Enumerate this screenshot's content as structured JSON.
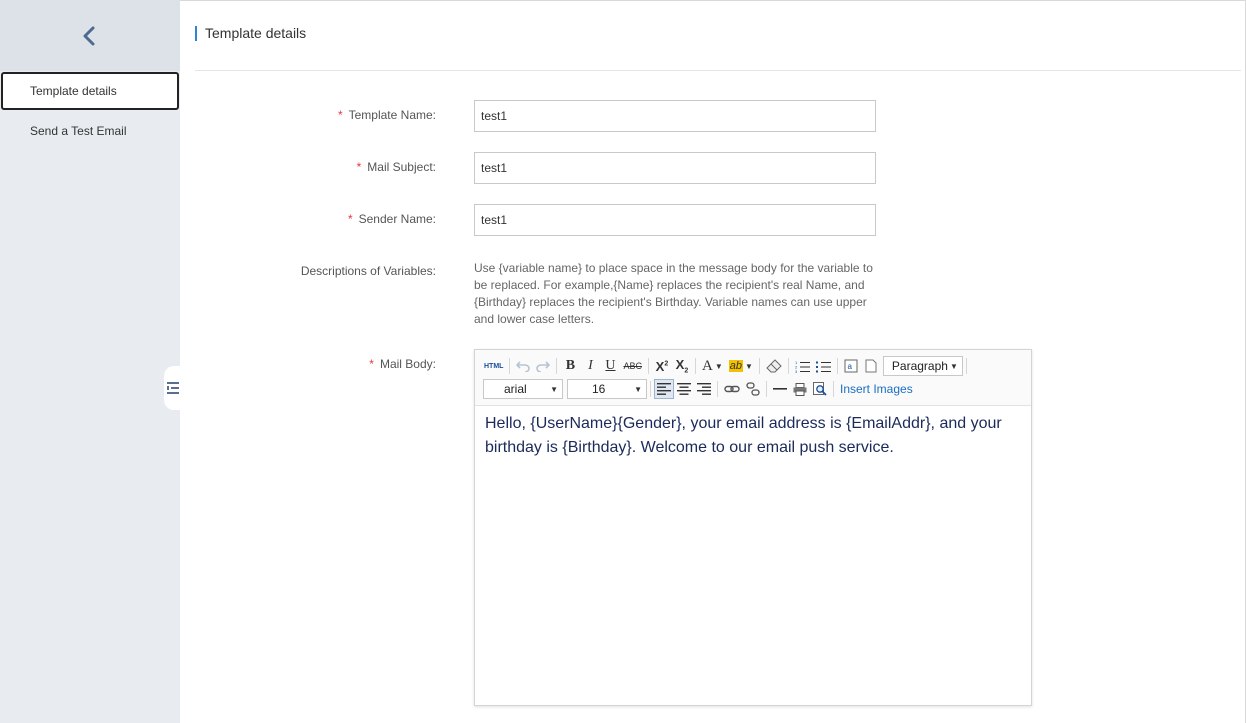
{
  "sidebar": {
    "back_icon": "chevron-left-icon",
    "items": [
      {
        "label": "Template details",
        "active": true
      },
      {
        "label": "Send a Test Email",
        "active": false
      }
    ],
    "collapse_icon": "collapse-menu-icon"
  },
  "header": {
    "title": "Template details"
  },
  "form": {
    "template_name": {
      "label": "Template Name:",
      "value": "test1",
      "required": true
    },
    "mail_subject": {
      "label": "Mail Subject:",
      "value": "test1",
      "required": true
    },
    "sender_name": {
      "label": "Sender Name:",
      "value": "test1",
      "required": true
    },
    "variables": {
      "label": "Descriptions of Variables:",
      "text": "Use {variable name} to place space in the message body for the variable to be replaced. For example,{Name} replaces the recipient's real Name, and {Birthday} replaces the recipient's Birthday. Variable names can use upper and lower case letters."
    },
    "mail_body": {
      "label": "Mail Body:",
      "required": true,
      "content": "Hello, {UserName}{Gender}, your email address is {EmailAddr}, and your birthday is {Birthday}. Welcome to our email push service."
    }
  },
  "required_mark": "*",
  "editor_toolbar": {
    "html_label": "HTML",
    "bold": "B",
    "italic": "I",
    "underline": "U",
    "strike": "ABC",
    "font_color": "A",
    "highlight": "ab",
    "paragraph_select": "Paragraph",
    "font_family_select": "arial",
    "font_size_select": "16",
    "insert_images": "Insert Images"
  },
  "colors": {
    "accent": "#2a87d1",
    "required": "#e4393c",
    "link": "#1a6fc4",
    "sidebar_bg": "#e8ecf1"
  }
}
